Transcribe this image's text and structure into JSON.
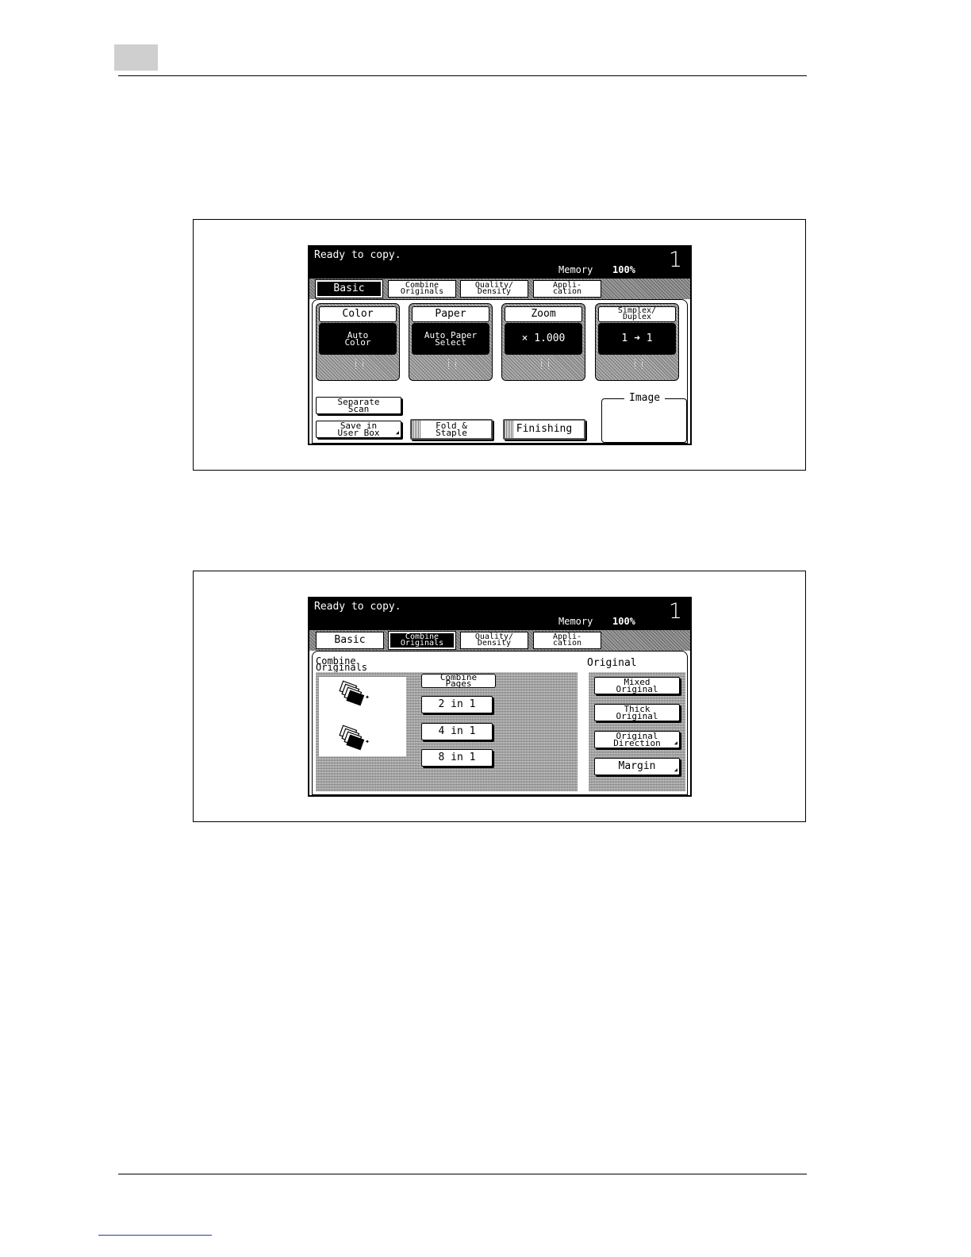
{
  "screen_top": {
    "status": "Ready to copy.",
    "memory_label": "Memory",
    "memory_value": "100%",
    "copy_count": "1",
    "tabs": [
      {
        "line1": "Basic",
        "line2": ""
      },
      {
        "line1": "Combine",
        "line2": "Originals"
      },
      {
        "line1": "Quality/",
        "line2": "Density"
      },
      {
        "line1": "Appli-",
        "line2": "cation"
      }
    ],
    "functions": [
      {
        "label": "Color",
        "label2": "",
        "value1": "Auto",
        "value2": "Color"
      },
      {
        "label": "Paper",
        "label2": "",
        "value1": "Auto Paper",
        "value2": "Select"
      },
      {
        "label": "Zoom",
        "label2": "",
        "value1": "× 1.000",
        "value2": ""
      },
      {
        "label": "Simplex/",
        "label2": "Duplex",
        "value1": "1 ➜ 1",
        "value2": ""
      }
    ],
    "separate_scan": {
      "line1": "Separate",
      "line2": "Scan"
    },
    "save_in_user_box": {
      "line1": "Save in",
      "line2": "User Box"
    },
    "fold_staple": {
      "line1": "Fold &",
      "line2": "Staple"
    },
    "finishing": "Finishing",
    "image_title": "Image"
  },
  "screen_bottom": {
    "status": "Ready to copy.",
    "memory_label": "Memory",
    "memory_value": "100%",
    "copy_count": "1",
    "tabs": [
      {
        "line1": "Basic",
        "line2": ""
      },
      {
        "line1": "Combine",
        "line2": "Originals"
      },
      {
        "line1": "Quality/",
        "line2": "Density"
      },
      {
        "line1": "Appli-",
        "line2": "cation"
      }
    ],
    "section_line1": "Combine",
    "section_line2": "Originals",
    "combine_pages_line1": "Combine",
    "combine_pages_line2": "Pages",
    "combine_options": [
      "2 in 1",
      "4 in 1",
      "8 in 1"
    ],
    "original_title": "Original",
    "original_buttons": [
      {
        "line1": "Mixed",
        "line2": "Original"
      },
      {
        "line1": "Thick",
        "line2": "Original"
      },
      {
        "line1": "Original",
        "line2": "Direction"
      },
      {
        "line1": "Margin",
        "line2": ""
      }
    ]
  }
}
